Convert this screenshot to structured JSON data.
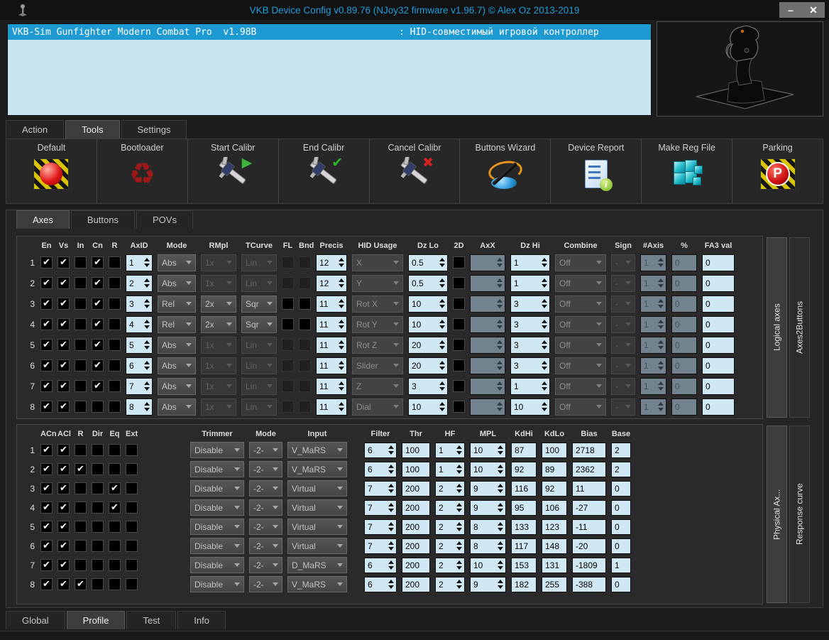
{
  "window": {
    "title": "VKB Device Config v0.89.76 (NJoy32 firmware v1.96.7) © Alex Oz 2013-2019",
    "minimize_glyph": "–",
    "close_glyph": "✕"
  },
  "colors": {
    "accent_blue": "#1e9ad2",
    "title_blue": "#1f9ddc",
    "field_blue": "#cfe8f4",
    "panel_dark": "#272727",
    "hazard_yellow": "#d8c400",
    "alert_red": "#e01818"
  },
  "device_list": {
    "selected_device": {
      "name": "VKB-Sim Gunfighter Modern Combat Pro  v1.98B",
      "description": ": HID-совместимый игровой контроллер"
    }
  },
  "main_tabs": [
    {
      "label": "Action",
      "selected": false
    },
    {
      "label": "Tools",
      "selected": true
    },
    {
      "label": "Settings",
      "selected": false
    }
  ],
  "toolbar": [
    {
      "label": "Default",
      "icon": "default-hazard-icon"
    },
    {
      "label": "Bootloader",
      "icon": "bootloader-recycle-icon"
    },
    {
      "label": "Start Calibr",
      "icon": "start-calibr-icon"
    },
    {
      "label": "End Calibr",
      "icon": "end-calibr-icon"
    },
    {
      "label": "Cancel Calibr",
      "icon": "cancel-calibr-icon"
    },
    {
      "label": "Buttons Wizard",
      "icon": "buttons-wizard-icon"
    },
    {
      "label": "Device Report",
      "icon": "device-report-icon"
    },
    {
      "label": "Make Reg File",
      "icon": "make-reg-file-icon"
    },
    {
      "label": "Parking",
      "icon": "parking-icon"
    }
  ],
  "content_tabs": [
    {
      "label": "Axes",
      "selected": true
    },
    {
      "label": "Buttons",
      "selected": false
    },
    {
      "label": "POVs",
      "selected": false
    }
  ],
  "logical_axes": {
    "checkbox_headers": [
      "En",
      "Vs",
      "In",
      "Cn",
      "R"
    ],
    "column_headers": [
      "AxID",
      "Mode",
      "RMpl",
      "TCurve",
      "FL",
      "Bnd",
      "Precis",
      "HID Usage",
      "Dz Lo",
      "2D",
      "AxX",
      "Dz Hi",
      "Combine",
      "Sign",
      "#Axis",
      "%",
      "FA3 val"
    ],
    "side_tabs": [
      {
        "label": "Logical axes",
        "selected": true
      },
      {
        "label": "Axes2Buttons",
        "selected": false
      }
    ],
    "rows": [
      {
        "n": "1",
        "en": true,
        "vs": true,
        "in": false,
        "cn": true,
        "r": false,
        "axid": "1",
        "mode": "Abs",
        "rmpl": "1x",
        "rmpl_on": false,
        "tcurve": "Lin",
        "tcurve_on": false,
        "flbnd_on": false,
        "precis": "12",
        "hid": "X",
        "dz_lo": "0.5",
        "axx": "",
        "dz_hi": "1",
        "combine": "Off",
        "sign": "-",
        "num_axis": "1",
        "pct": "0",
        "fa3": "0"
      },
      {
        "n": "2",
        "en": true,
        "vs": true,
        "in": false,
        "cn": true,
        "r": false,
        "axid": "2",
        "mode": "Abs",
        "rmpl": "1x",
        "rmpl_on": false,
        "tcurve": "Lin",
        "tcurve_on": false,
        "flbnd_on": false,
        "precis": "12",
        "hid": "Y",
        "dz_lo": "0.5",
        "axx": "",
        "dz_hi": "1",
        "combine": "Off",
        "sign": "-",
        "num_axis": "1",
        "pct": "0",
        "fa3": "0"
      },
      {
        "n": "3",
        "en": true,
        "vs": true,
        "in": false,
        "cn": true,
        "r": false,
        "axid": "3",
        "mode": "Rel",
        "rmpl": "2x",
        "rmpl_on": true,
        "tcurve": "Sqr",
        "tcurve_on": true,
        "flbnd_on": true,
        "precis": "11",
        "hid": "Rot X",
        "dz_lo": "10",
        "axx": "",
        "dz_hi": "3",
        "combine": "Off",
        "sign": "-",
        "num_axis": "1",
        "pct": "0",
        "fa3": "0"
      },
      {
        "n": "4",
        "en": true,
        "vs": true,
        "in": false,
        "cn": true,
        "r": false,
        "axid": "4",
        "mode": "Rel",
        "rmpl": "2x",
        "rmpl_on": true,
        "tcurve": "Sqr",
        "tcurve_on": true,
        "flbnd_on": true,
        "precis": "11",
        "hid": "Rot Y",
        "dz_lo": "10",
        "axx": "",
        "dz_hi": "3",
        "combine": "Off",
        "sign": "-",
        "num_axis": "1",
        "pct": "0",
        "fa3": "0"
      },
      {
        "n": "5",
        "en": true,
        "vs": true,
        "in": false,
        "cn": true,
        "r": false,
        "axid": "5",
        "mode": "Abs",
        "rmpl": "1x",
        "rmpl_on": false,
        "tcurve": "Lin",
        "tcurve_on": false,
        "flbnd_on": false,
        "precis": "11",
        "hid": "Rot Z",
        "dz_lo": "20",
        "axx": "",
        "dz_hi": "3",
        "combine": "Off",
        "sign": "-",
        "num_axis": "1",
        "pct": "0",
        "fa3": "0"
      },
      {
        "n": "6",
        "en": true,
        "vs": true,
        "in": false,
        "cn": true,
        "r": false,
        "axid": "6",
        "mode": "Abs",
        "rmpl": "1x",
        "rmpl_on": false,
        "tcurve": "Lin",
        "tcurve_on": false,
        "flbnd_on": false,
        "precis": "11",
        "hid": "Slider",
        "dz_lo": "20",
        "axx": "",
        "dz_hi": "3",
        "combine": "Off",
        "sign": "-",
        "num_axis": "1",
        "pct": "0",
        "fa3": "0"
      },
      {
        "n": "7",
        "en": true,
        "vs": true,
        "in": false,
        "cn": true,
        "r": false,
        "axid": "7",
        "mode": "Abs",
        "rmpl": "1x",
        "rmpl_on": false,
        "tcurve": "Lin",
        "tcurve_on": false,
        "flbnd_on": false,
        "precis": "11",
        "hid": "Z",
        "dz_lo": "3",
        "axx": "",
        "dz_hi": "1",
        "combine": "Off",
        "sign": "-",
        "num_axis": "1",
        "pct": "0",
        "fa3": "0"
      },
      {
        "n": "8",
        "en": true,
        "vs": true,
        "in": false,
        "cn": false,
        "r": false,
        "axid": "8",
        "mode": "Abs",
        "rmpl": "1x",
        "rmpl_on": false,
        "tcurve": "Lin",
        "tcurve_on": false,
        "flbnd_on": false,
        "precis": "11",
        "hid": "Dial",
        "dz_lo": "10",
        "axx": "",
        "dz_hi": "10",
        "combine": "Off",
        "sign": "-",
        "num_axis": "1",
        "pct": "0",
        "fa3": "0"
      }
    ]
  },
  "physical_axes": {
    "checkbox_headers": [
      "ACn",
      "ACl",
      "R",
      "Dir",
      "Eq",
      "Ext"
    ],
    "column_headers": [
      "Trimmer",
      "Mode",
      "Input",
      "Filter",
      "Thr",
      "HF",
      "MPL",
      "KdHi",
      "KdLo",
      "Bias",
      "Base"
    ],
    "side_tabs": [
      {
        "label": "Physical Ax...",
        "selected": true
      },
      {
        "label": "Response curve",
        "selected": false
      }
    ],
    "rows": [
      {
        "n": "1",
        "acn": true,
        "acl": true,
        "r": false,
        "dir": false,
        "eq": false,
        "ext": false,
        "trimmer": "Disable",
        "mode": "-2-",
        "input": "V_MaRS",
        "filter": "6",
        "thr": "100",
        "hf": "1",
        "mpl": "10",
        "kdhi": "87",
        "kdlo": "100",
        "bias": "2718",
        "base": "2"
      },
      {
        "n": "2",
        "acn": true,
        "acl": true,
        "r": true,
        "dir": false,
        "eq": false,
        "ext": false,
        "trimmer": "Disable",
        "mode": "-2-",
        "input": "V_MaRS",
        "filter": "6",
        "thr": "100",
        "hf": "1",
        "mpl": "10",
        "kdhi": "92",
        "kdlo": "89",
        "bias": "2362",
        "base": "2"
      },
      {
        "n": "3",
        "acn": true,
        "acl": true,
        "r": false,
        "dir": false,
        "eq": true,
        "ext": false,
        "trimmer": "Disable",
        "mode": "-2-",
        "input": "Virtual",
        "filter": "7",
        "thr": "200",
        "hf": "2",
        "mpl": "9",
        "kdhi": "116",
        "kdlo": "92",
        "bias": "11",
        "base": "0"
      },
      {
        "n": "4",
        "acn": true,
        "acl": true,
        "r": false,
        "dir": false,
        "eq": true,
        "ext": false,
        "trimmer": "Disable",
        "mode": "-2-",
        "input": "Virtual",
        "filter": "7",
        "thr": "200",
        "hf": "2",
        "mpl": "9",
        "kdhi": "95",
        "kdlo": "106",
        "bias": "-27",
        "base": "0"
      },
      {
        "n": "5",
        "acn": true,
        "acl": true,
        "r": false,
        "dir": false,
        "eq": false,
        "ext": false,
        "trimmer": "Disable",
        "mode": "-2-",
        "input": "Virtual",
        "filter": "7",
        "thr": "200",
        "hf": "2",
        "mpl": "8",
        "kdhi": "133",
        "kdlo": "123",
        "bias": "-11",
        "base": "0"
      },
      {
        "n": "6",
        "acn": true,
        "acl": true,
        "r": false,
        "dir": false,
        "eq": false,
        "ext": false,
        "trimmer": "Disable",
        "mode": "-2-",
        "input": "Virtual",
        "filter": "7",
        "thr": "200",
        "hf": "2",
        "mpl": "8",
        "kdhi": "117",
        "kdlo": "148",
        "bias": "-20",
        "base": "0"
      },
      {
        "n": "7",
        "acn": true,
        "acl": true,
        "r": false,
        "dir": false,
        "eq": false,
        "ext": false,
        "trimmer": "Disable",
        "mode": "-2-",
        "input": "D_MaRS",
        "filter": "6",
        "thr": "200",
        "hf": "2",
        "mpl": "10",
        "kdhi": "153",
        "kdlo": "131",
        "bias": "-1809",
        "base": "1"
      },
      {
        "n": "8",
        "acn": true,
        "acl": true,
        "r": true,
        "dir": false,
        "eq": false,
        "ext": false,
        "trimmer": "Disable",
        "mode": "-2-",
        "input": "V_MaRS",
        "filter": "6",
        "thr": "200",
        "hf": "2",
        "mpl": "9",
        "kdhi": "182",
        "kdlo": "255",
        "bias": "-388",
        "base": "0"
      }
    ]
  },
  "bottom_tabs": [
    {
      "label": "Global",
      "selected": false
    },
    {
      "label": "Profile",
      "selected": true
    },
    {
      "label": "Test",
      "selected": false
    },
    {
      "label": "Info",
      "selected": false
    }
  ]
}
